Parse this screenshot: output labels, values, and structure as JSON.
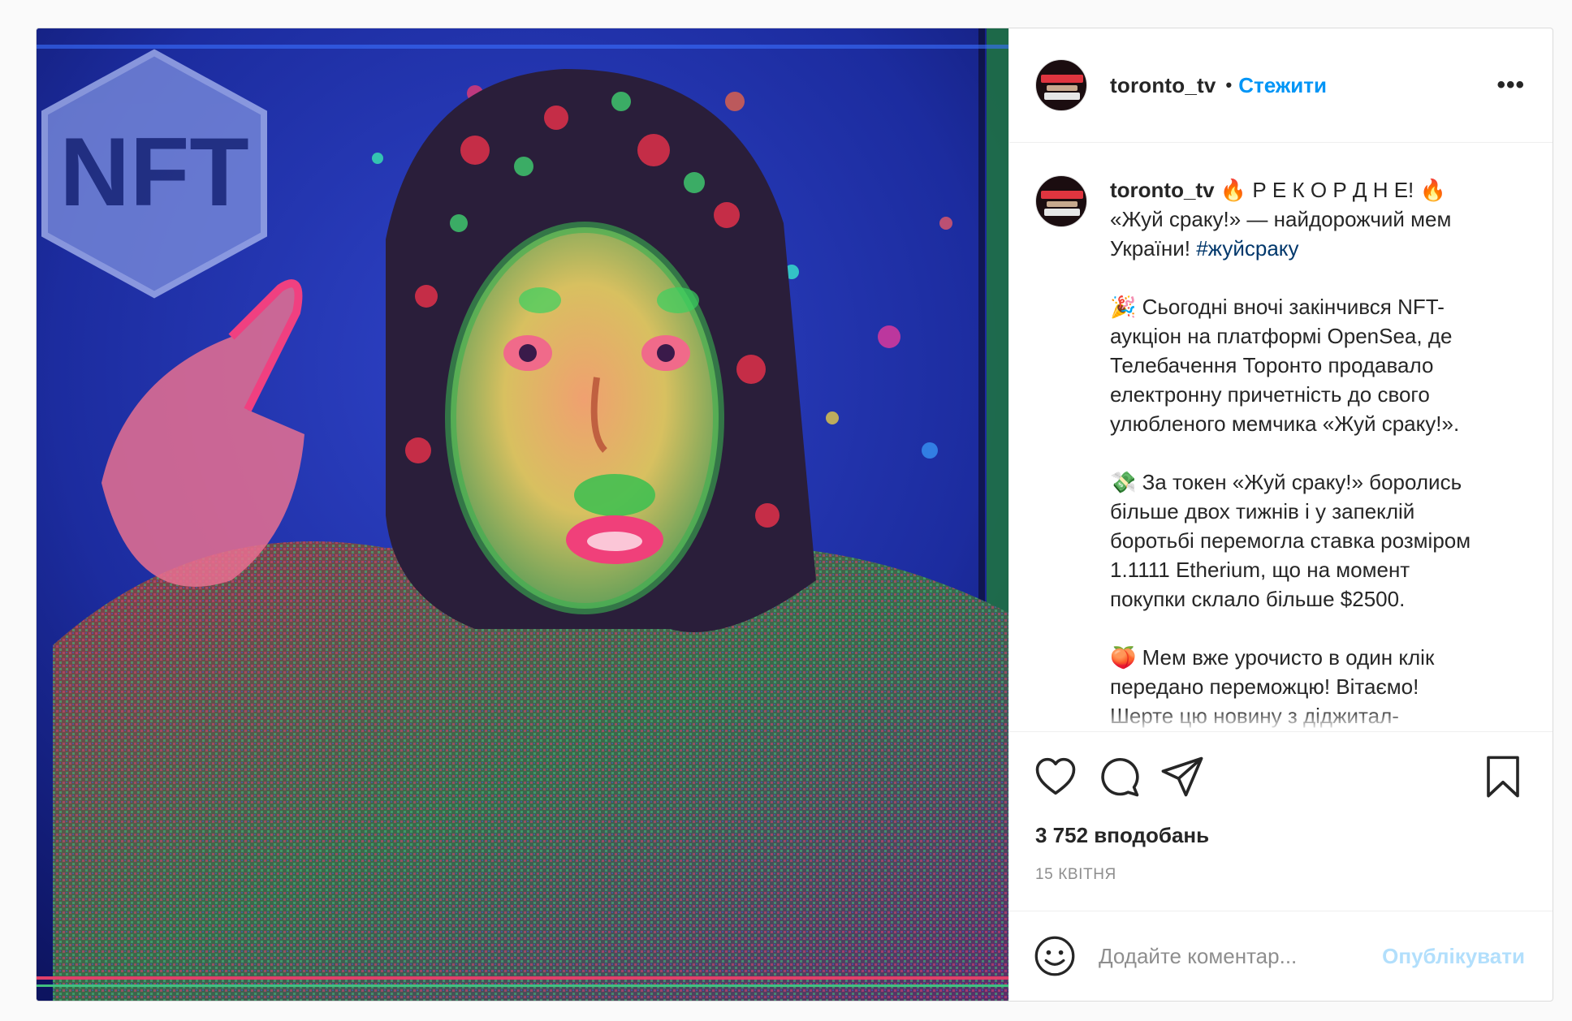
{
  "post": {
    "username": "toronto_tv",
    "separator": "•",
    "follow_label": "Стежити",
    "more_icon": "more-options-icon",
    "more_glyph": "•••",
    "media_badge_text": "NFT",
    "caption": {
      "username": "toronto_tv",
      "line1": " 🔥 Р Е К О Р Д Н Е! 🔥\n«Жуй сраку!» — найдорожчий мем\nУкраїни! ",
      "hashtag": "#жуйсраку",
      "rest": "\n\n🎉 Сьогодні вночі закінчився NFT-\nаукціон на платформі OpenSea, де\nТелебачення Торонто продавало\nелектронну причетність до свого\nулюбленого мемчика «Жуй сраку!».\n\n💸 За токен «Жуй сраку!» боролись\nбільше двох тижнів і у запеклій\nборотьбі перемогла ставка розміром\n1.1111 Etherium, що на момент\nпокупки склало більше $2500.\n\n🍑 Мем вже урочисто в один клік\nпередано переможцю! Вітаємо!\nШерте цю новину з діджитал-\nсвітом та Україною! Нехай знає!"
    },
    "actions": {
      "like_icon": "heart-icon",
      "comment_icon": "comment-icon",
      "share_icon": "share-icon",
      "save_icon": "bookmark-icon"
    },
    "likes": "3 752 вподобань",
    "date": "15 квітня",
    "comment": {
      "emoji_icon": "emoji-icon",
      "placeholder": "Додайте коментар...",
      "publish_label": "Опублікувати"
    }
  },
  "colors": {
    "link_blue": "#0095f6",
    "hashtag": "#00376b",
    "publish_disabled": "#b2dffc",
    "muted": "#8e8e8e"
  }
}
